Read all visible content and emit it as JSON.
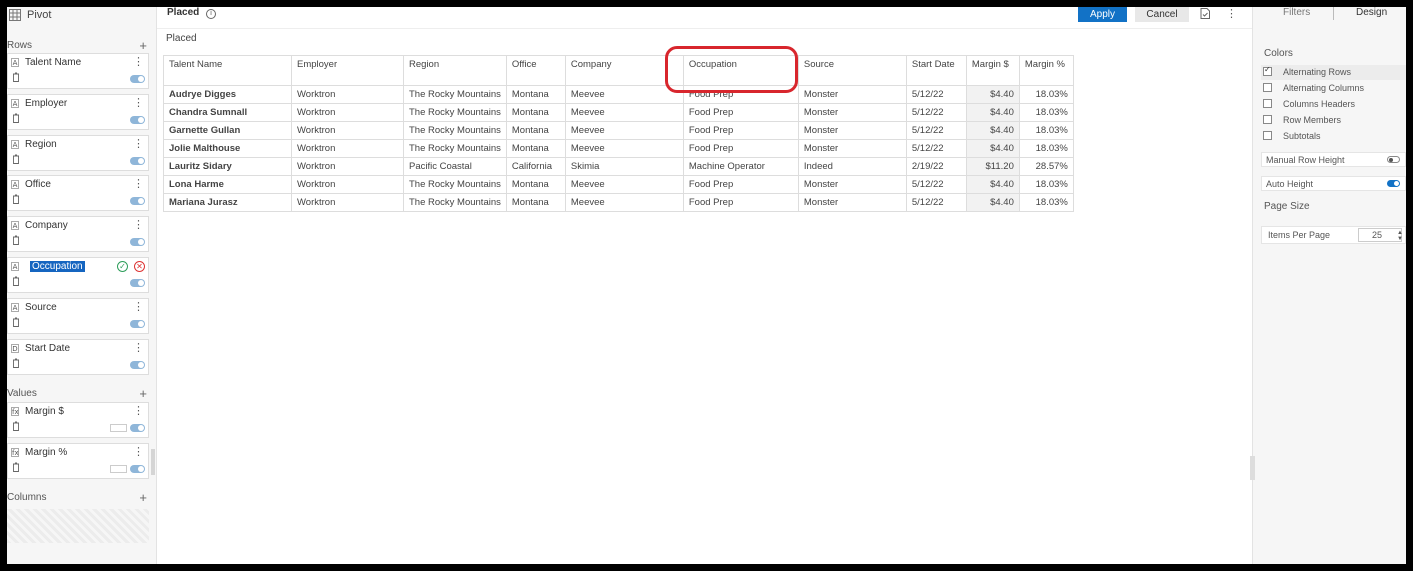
{
  "left": {
    "title": "Pivot",
    "rows_label": "Rows",
    "values_label": "Values",
    "columns_label": "Columns",
    "row_fields": [
      {
        "type": "A",
        "name": "Talent Name"
      },
      {
        "type": "A",
        "name": "Employer"
      },
      {
        "type": "A",
        "name": "Region"
      },
      {
        "type": "A",
        "name": "Office"
      },
      {
        "type": "A",
        "name": "Company"
      },
      {
        "type": "A",
        "name": "Occupation"
      },
      {
        "type": "A",
        "name": "Source"
      },
      {
        "type": "D",
        "name": "Start Date"
      }
    ],
    "value_fields": [
      {
        "type": "fx",
        "name": "Margin $"
      },
      {
        "type": "fx",
        "name": "Margin %"
      }
    ]
  },
  "center": {
    "title": "Placed",
    "apply_label": "Apply",
    "cancel_label": "Cancel",
    "subtitle": "Placed",
    "headers": [
      "Talent Name",
      "Employer",
      "Region",
      "Office",
      "Company",
      "Occupation",
      "Source",
      "Start Date",
      "Margin $",
      "Margin %"
    ],
    "rows": [
      [
        "Audrye Digges",
        "Worktron",
        "The Rocky Mountains",
        "Montana",
        "Meevee",
        "Food Prep",
        "Monster",
        "5/12/22",
        "$4.40",
        "18.03%"
      ],
      [
        "Chandra Sumnall",
        "Worktron",
        "The Rocky Mountains",
        "Montana",
        "Meevee",
        "Food Prep",
        "Monster",
        "5/12/22",
        "$4.40",
        "18.03%"
      ],
      [
        "Garnette Gullan",
        "Worktron",
        "The Rocky Mountains",
        "Montana",
        "Meevee",
        "Food Prep",
        "Monster",
        "5/12/22",
        "$4.40",
        "18.03%"
      ],
      [
        "Jolie Malthouse",
        "Worktron",
        "The Rocky Mountains",
        "Montana",
        "Meevee",
        "Food Prep",
        "Monster",
        "5/12/22",
        "$4.40",
        "18.03%"
      ],
      [
        "Lauritz Sidary",
        "Worktron",
        "Pacific Coastal",
        "California",
        "Skimia",
        "Machine Operator",
        "Indeed",
        "2/19/22",
        "$11.20",
        "28.57%"
      ],
      [
        "Lona Harme",
        "Worktron",
        "The Rocky Mountains",
        "Montana",
        "Meevee",
        "Food Prep",
        "Monster",
        "5/12/22",
        "$4.40",
        "18.03%"
      ],
      [
        "Mariana Jurasz",
        "Worktron",
        "The Rocky Mountains",
        "Montana",
        "Meevee",
        "Food Prep",
        "Monster",
        "5/12/22",
        "$4.40",
        "18.03%"
      ]
    ]
  },
  "right": {
    "tab_filters": "Filters",
    "tab_design": "Design",
    "colors_label": "Colors",
    "color_options": [
      {
        "label": "Alternating Rows",
        "checked": true
      },
      {
        "label": "Alternating Columns",
        "checked": false
      },
      {
        "label": "Columns Headers",
        "checked": false
      },
      {
        "label": "Row Members",
        "checked": false
      },
      {
        "label": "Subtotals",
        "checked": false
      }
    ],
    "manual_row_height": "Manual Row Height",
    "auto_height": "Auto Height",
    "page_size_label": "Page Size",
    "items_per_page_label": "Items Per Page",
    "items_per_page_value": "25"
  },
  "colors": {
    "accent": "#1272c6",
    "highlight_ring": "#d8262d"
  }
}
